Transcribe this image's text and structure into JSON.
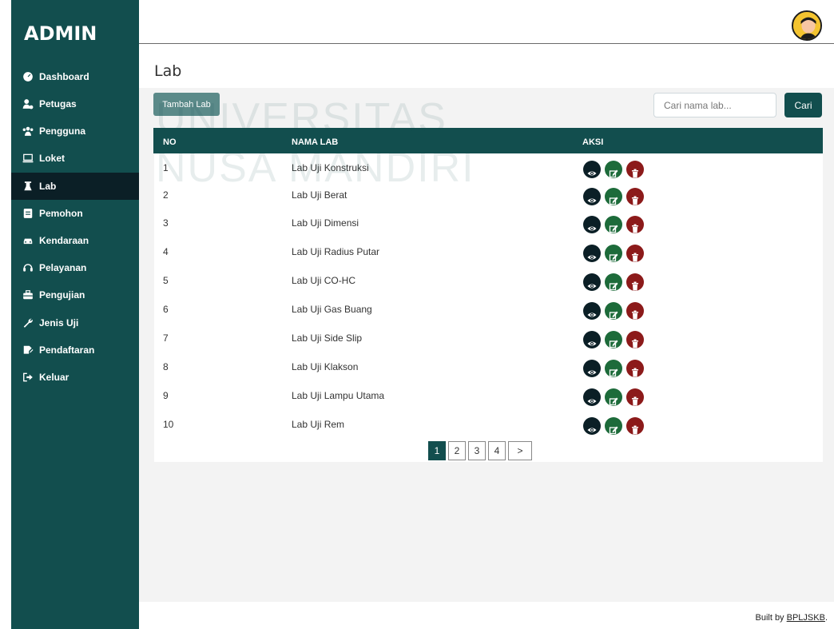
{
  "sidebar": {
    "brand": "ADMIN",
    "items": [
      {
        "label": "Dashboard",
        "icon": "dashboard-icon"
      },
      {
        "label": "Petugas",
        "icon": "user-tie-icon"
      },
      {
        "label": "Pengguna",
        "icon": "users-icon"
      },
      {
        "label": "Loket",
        "icon": "laptop-icon"
      },
      {
        "label": "Lab",
        "icon": "flask-icon",
        "active": true
      },
      {
        "label": "Pemohon",
        "icon": "id-card-icon"
      },
      {
        "label": "Kendaraan",
        "icon": "car-icon"
      },
      {
        "label": "Pelayanan",
        "icon": "headset-icon"
      },
      {
        "label": "Pengujian",
        "icon": "toolbox-icon"
      },
      {
        "label": "Jenis Uji",
        "icon": "wrench-icon"
      },
      {
        "label": "Pendaftaran",
        "icon": "signature-icon"
      },
      {
        "label": "Keluar",
        "icon": "sign-out-icon"
      }
    ]
  },
  "header": {
    "avatar": "user-avatar-icon"
  },
  "page": {
    "title": "Lab",
    "add_label": "Tambah Lab",
    "search_placeholder": "Cari nama lab...",
    "search_label": "Cari"
  },
  "table": {
    "columns": [
      "NO",
      "NAMA LAB",
      "AKSI"
    ],
    "rows": [
      {
        "no": "1",
        "name": "Lab Uji Konstruksi"
      },
      {
        "no": "2",
        "name": "Lab Uji Berat"
      },
      {
        "no": "3",
        "name": "Lab Uji Dimensi"
      },
      {
        "no": "4",
        "name": "Lab Uji Radius Putar"
      },
      {
        "no": "5",
        "name": "Lab Uji CO-HC"
      },
      {
        "no": "6",
        "name": "Lab Uji Gas Buang"
      },
      {
        "no": "7",
        "name": "Lab Uji Side Slip"
      },
      {
        "no": "8",
        "name": "Lab Uji Klakson"
      },
      {
        "no": "9",
        "name": "Lab Uji Lampu Utama"
      },
      {
        "no": "10",
        "name": "Lab Uji Rem"
      }
    ],
    "actions": [
      "view-icon",
      "edit-icon",
      "delete-icon"
    ]
  },
  "pagination": {
    "pages": [
      "1",
      "2",
      "3",
      "4"
    ],
    "next": ">",
    "current": "1"
  },
  "watermark": {
    "line1": "UNIVERSITAS",
    "line2": "NUSA MANDIRI"
  },
  "footer": {
    "prefix": "Built by ",
    "link": "BPLJSKB",
    "suffix": "."
  },
  "colors": {
    "primary": "#124e4e",
    "active_nav": "#0b1f26",
    "edit": "#1d6b3a",
    "delete": "#8c1a1a"
  }
}
